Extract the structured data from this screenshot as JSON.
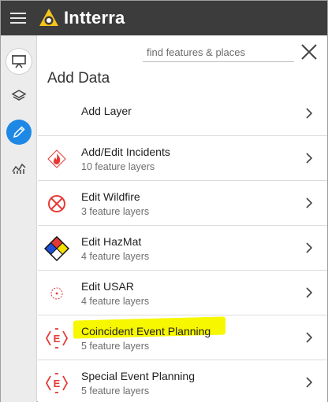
{
  "app": {
    "brand": "Intterra",
    "colors": {
      "topbar": "#3c3c3c",
      "accent": "#1e88e5",
      "logo": "#f5c518",
      "highlight": "#f7f700",
      "icon_red": "#e53935"
    }
  },
  "topbar": {
    "menu_icon": "hamburger-icon",
    "logo_icon": "intterra-logo-icon"
  },
  "rail": {
    "items": [
      {
        "icon": "presentation-icon",
        "state": "ring"
      },
      {
        "icon": "layers-icon",
        "state": "normal"
      },
      {
        "icon": "pencil-icon",
        "state": "active"
      },
      {
        "icon": "analytics-icon",
        "state": "normal"
      }
    ]
  },
  "panel": {
    "search_placeholder": "find features & places",
    "close_icon": "close-icon",
    "title": "Add Data",
    "items": [
      {
        "label": "Add Layer",
        "sub": "",
        "icon": ""
      },
      {
        "label": "Add/Edit Incidents",
        "sub": "10 feature layers",
        "icon": "fire-icon"
      },
      {
        "label": "Edit Wildfire",
        "sub": "3 feature layers",
        "icon": "wildfire-no-icon"
      },
      {
        "label": "Edit HazMat",
        "sub": "4 feature layers",
        "icon": "hazmat-diamond-icon"
      },
      {
        "label": "Edit USAR",
        "sub": "4 feature layers",
        "icon": "usar-icon"
      },
      {
        "label": "Coincident Event Planning",
        "sub": "5 feature layers",
        "icon": "event-e-icon"
      },
      {
        "label": "Special Event Planning",
        "sub": "5 feature layers",
        "icon": "event-e-icon"
      }
    ]
  }
}
